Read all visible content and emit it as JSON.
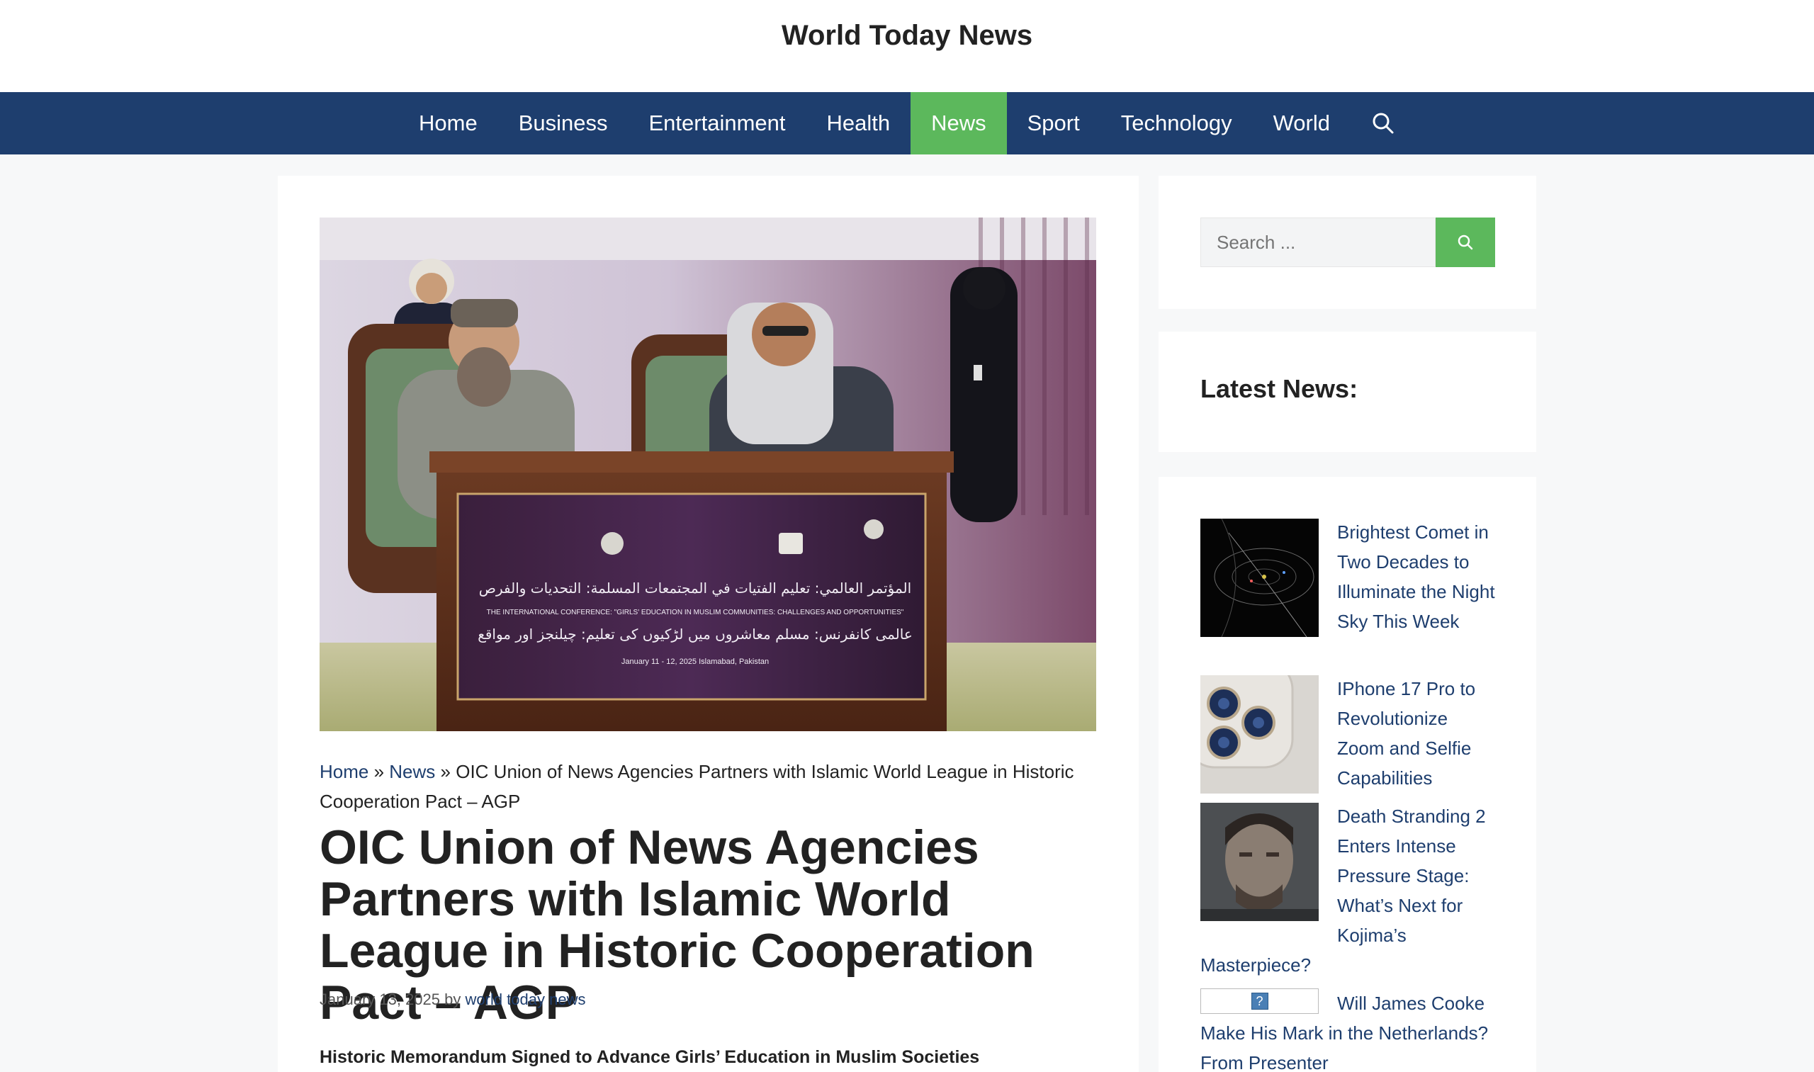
{
  "site": {
    "title": "World Today News"
  },
  "nav": {
    "items": [
      {
        "label": "Home"
      },
      {
        "label": "Business"
      },
      {
        "label": "Entertainment"
      },
      {
        "label": "Health"
      },
      {
        "label": "News"
      },
      {
        "label": "Sport"
      },
      {
        "label": "Technology"
      },
      {
        "label": "World"
      }
    ],
    "active": "News",
    "search_icon": "search-icon"
  },
  "hero": {
    "banner_arabic": "المؤتمر العالمي: تعليم الفتيات في المجتمعات المسلمة: التحديات والفرص",
    "banner_english": "THE INTERNATIONAL CONFERENCE: \"GIRLS' EDUCATION IN MUSLIM COMMUNITIES: CHALLENGES AND OPPORTUNITIES\"",
    "banner_urdu": "عالمی کانفرنس: مسلم معاشروں میں لڑکیوں کی تعلیم: چیلنجز اور مواقع",
    "banner_date": "January 11 - 12, 2025 Islamabad, Pakistan"
  },
  "breadcrumb": {
    "home": "Home",
    "sep1": " » ",
    "news": "News",
    "sep2": " » ",
    "current": "OIC Union of News Agencies Partners with Islamic World League in Historic Cooperation Pact – AGP"
  },
  "article": {
    "title": "OIC Union of News Agencies Partners with Islamic World League in Historic Cooperation Pact – AGP",
    "date": "January 13, 2025",
    "by": " by ",
    "author": "world today news",
    "subhead": "Historic Memorandum Signed to Advance Girls’ Education in Muslim Societies"
  },
  "sidebar": {
    "search_placeholder": "Search ...",
    "latest_title": "Latest News:",
    "news": [
      {
        "title": "Brightest Comet in Two Decades to Illuminate the Night Sky This Week"
      },
      {
        "title": "IPhone 17 Pro to Revolutionize Zoom and Selfie Capabilities"
      },
      {
        "title": "Death Stranding 2 Enters Intense Pressure Stage: What’s Next for Kojima’s Masterpiece?"
      },
      {
        "title": "Will James Cooke Make His Mark in the Netherlands? From Presenter"
      }
    ],
    "broken_image_glyph": "?"
  },
  "colors": {
    "nav_bg": "#1e3e6e",
    "accent_green": "#5cb85c",
    "link": "#1e3e6e"
  }
}
